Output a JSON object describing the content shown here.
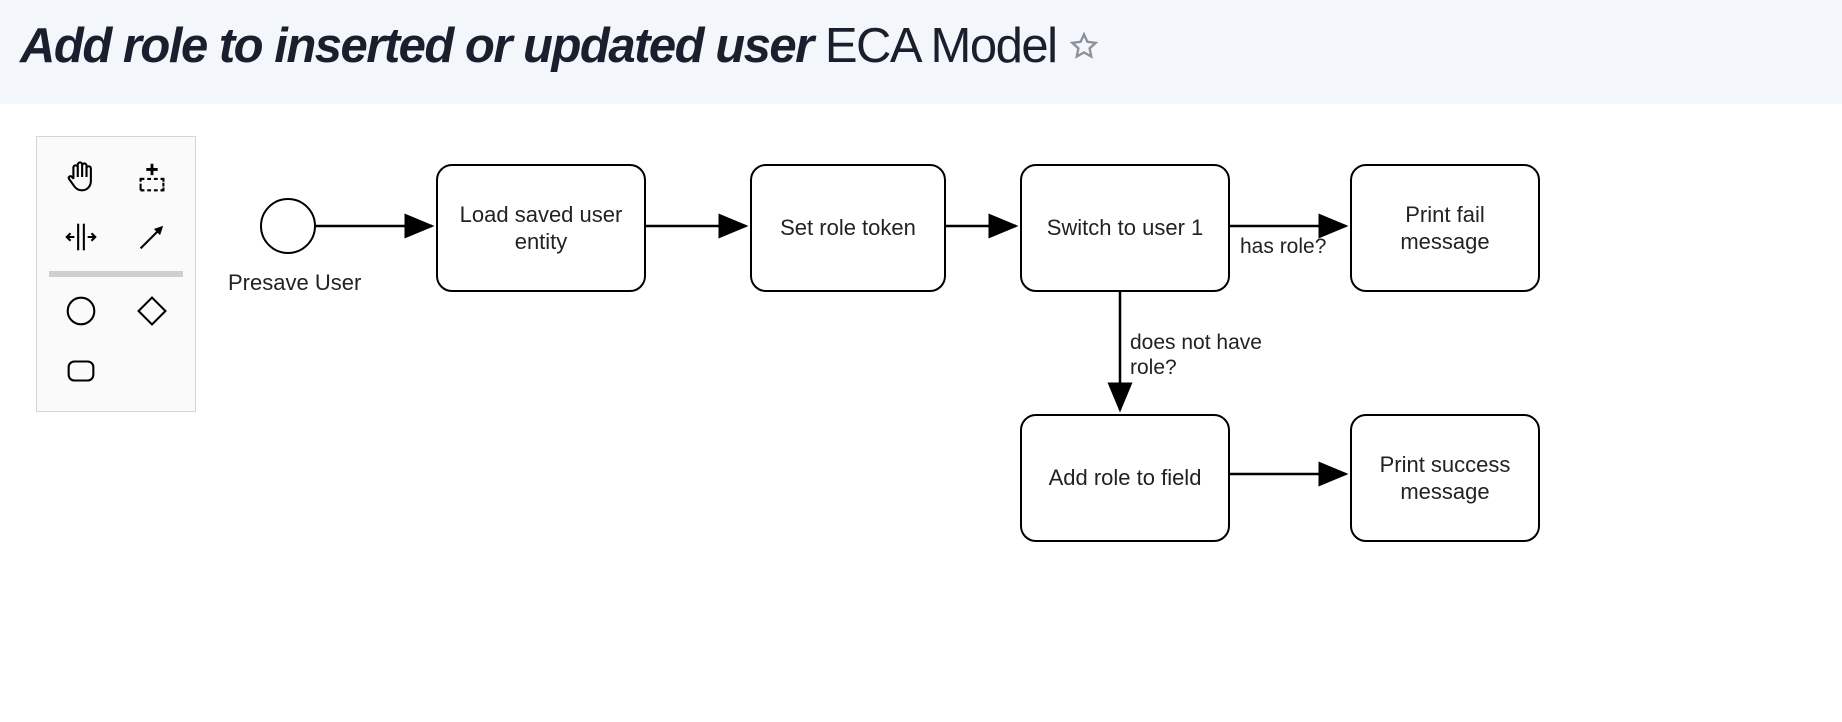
{
  "header": {
    "title_italic": "Add role to inserted or updated user",
    "title_suffix": "ECA Model"
  },
  "toolbox": {
    "tools": [
      "hand-tool",
      "lasso-tool",
      "space-tool",
      "connect-tool",
      "start-event-tool",
      "gateway-tool",
      "task-tool"
    ]
  },
  "diagram": {
    "start": {
      "label": "Presave User"
    },
    "nodes": {
      "load_entity": "Load saved user entity",
      "set_token": "Set role token",
      "switch_user": "Switch to user 1",
      "print_fail": "Print fail message",
      "add_role": "Add role to field",
      "print_success": "Print success message"
    },
    "edge_labels": {
      "has_role": "has role?",
      "no_role_l1": "does not have",
      "no_role_l2": "role?"
    }
  }
}
